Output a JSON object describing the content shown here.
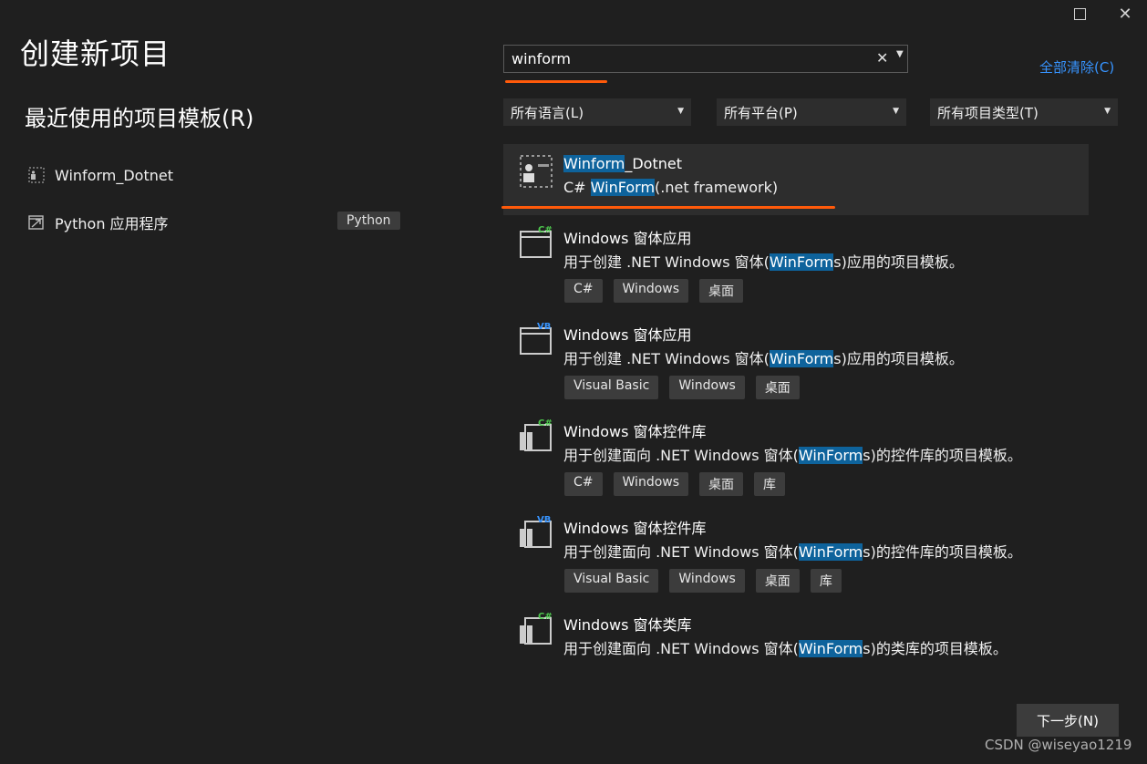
{
  "window": {
    "maximize_icon": "maximize-icon",
    "close_glyph": "✕"
  },
  "page_title": "创建新项目",
  "recent": {
    "title": "最近使用的项目模板(R)",
    "items": [
      {
        "label": "Winform_Dotnet",
        "tag": ""
      },
      {
        "label": "Python 应用程序",
        "tag": "Python"
      }
    ]
  },
  "search": {
    "value": "winform",
    "clear_glyph": "✕",
    "clear_all": "全部清除(C)"
  },
  "filters": [
    {
      "label": "所有语言(L)"
    },
    {
      "label": "所有平台(P)"
    },
    {
      "label": "所有项目类型(T)"
    }
  ],
  "results": [
    {
      "title_hl": "Winform",
      "title_rest": "_Dotnet",
      "desc_pre": "C# ",
      "desc_hl": "WinForm",
      "desc_post": "(.net framework)",
      "tags": [],
      "badge": ""
    },
    {
      "title": "Windows 窗体应用",
      "desc_pre": "用于创建 .NET Windows 窗体(",
      "desc_hl": "WinForm",
      "desc_post": "s)应用的项目模板。",
      "tags": [
        "C#",
        "Windows",
        "桌面"
      ],
      "badge": "C#"
    },
    {
      "title": "Windows 窗体应用",
      "desc_pre": "用于创建 .NET Windows 窗体(",
      "desc_hl": "WinForm",
      "desc_post": "s)应用的项目模板。",
      "tags": [
        "Visual Basic",
        "Windows",
        "桌面"
      ],
      "badge": "VB"
    },
    {
      "title": "Windows 窗体控件库",
      "desc_pre": "用于创建面向 .NET Windows 窗体(",
      "desc_hl": "WinForm",
      "desc_post": "s)的控件库的项目模板。",
      "tags": [
        "C#",
        "Windows",
        "桌面",
        "库"
      ],
      "badge": "C#"
    },
    {
      "title": "Windows 窗体控件库",
      "desc_pre": "用于创建面向 .NET Windows 窗体(",
      "desc_hl": "WinForm",
      "desc_post": "s)的控件库的项目模板。",
      "tags": [
        "Visual Basic",
        "Windows",
        "桌面",
        "库"
      ],
      "badge": "VB"
    },
    {
      "title": "Windows 窗体类库",
      "desc_pre": "用于创建面向 .NET Windows 窗体(",
      "desc_hl": "WinForm",
      "desc_post": "s)的类库的项目模板。",
      "tags": [],
      "badge": "C#"
    }
  ],
  "next_button": "下一步(N)",
  "watermark": "CSDN @wiseyao1219",
  "colors": {
    "accent_link": "#3794ff",
    "highlight": "#0e639c",
    "annotation": "#ff5a0a",
    "badge_cs": "#4ec94e",
    "badge_vb": "#3794ff"
  }
}
